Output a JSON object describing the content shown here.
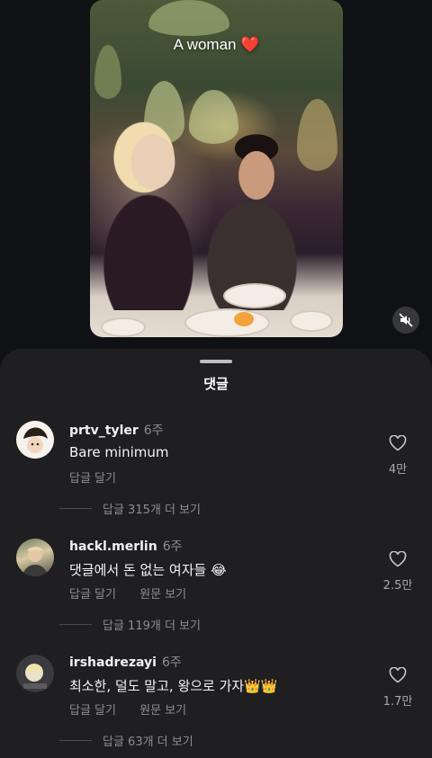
{
  "video": {
    "caption": "A woman ❤️"
  },
  "sheet": {
    "title": "댓글"
  },
  "comments": [
    {
      "username": "prtv_tyler",
      "time": "6주",
      "text": "Bare minimum",
      "actions": [
        "답글 달기"
      ],
      "likes": "4만",
      "more_replies": "답글 315개 더 보기",
      "avatar": "avatar-cartoon-icon"
    },
    {
      "username": "hackl.merlin",
      "time": "6주",
      "text": "댓글에서 돈 없는 여자들 😂",
      "actions": [
        "답글 달기",
        "원문 보기"
      ],
      "likes": "2.5만",
      "more_replies": "답글 119개 더 보기",
      "avatar": "avatar-photo-icon"
    },
    {
      "username": "irshadrezayi",
      "time": "6주",
      "text": "최소한, 덜도 말고, 왕으로 가자👑👑",
      "actions": [
        "답글 달기",
        "원문 보기"
      ],
      "likes": "1.7만",
      "more_replies": "답글 63개 더 보기",
      "avatar": "avatar-photo-icon"
    }
  ],
  "colors": {
    "background": "#0f1115",
    "sheet": "#1f1f22",
    "muted_text": "#8d8d92"
  }
}
